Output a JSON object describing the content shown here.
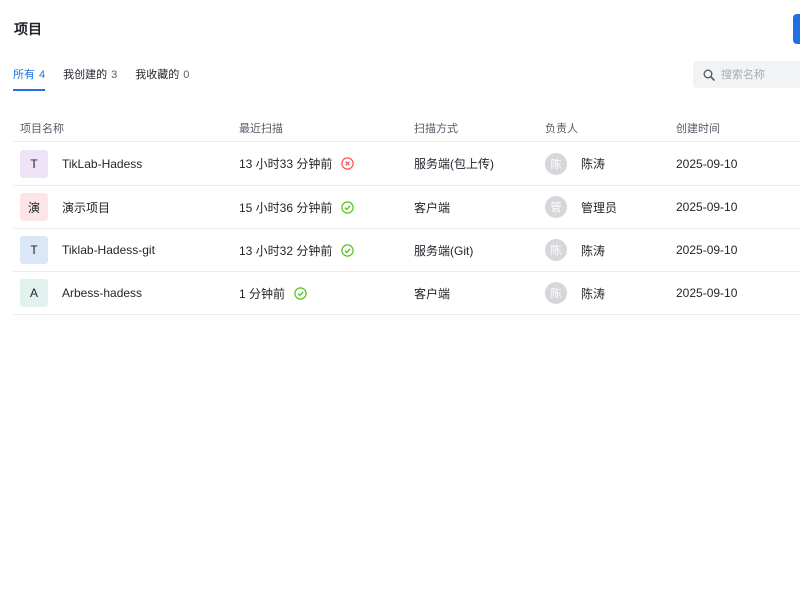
{
  "header": {
    "title": "项目"
  },
  "tabs": [
    {
      "label": "所有",
      "count": "4",
      "active": true
    },
    {
      "label": "我创建的",
      "count": "3",
      "active": false
    },
    {
      "label": "我收藏的",
      "count": "0",
      "active": false
    }
  ],
  "search": {
    "placeholder": "搜索名称",
    "value": "",
    "icon": "search-icon"
  },
  "table": {
    "columns": [
      "项目名称",
      "最近扫描",
      "扫描方式",
      "负责人",
      "创建时间"
    ],
    "rows": [
      {
        "avatar_letter": "T",
        "avatar_color": "#efe3f8",
        "name": "TikLab-Hadess",
        "last_scan": "13 小时33 分钟前",
        "scan_status": "failed",
        "status_color": "#f0565a",
        "scan_mode": "服务端(包上传)",
        "owner_avatar": "陈",
        "owner": "陈涛",
        "created": "2025-09-10"
      },
      {
        "avatar_letter": "演",
        "avatar_color": "#fbe5e6",
        "name": "演示项目",
        "last_scan": "15 小时36 分钟前",
        "scan_status": "success",
        "status_color": "#52c41a",
        "scan_mode": "客户端",
        "owner_avatar": "管",
        "owner": "管理员",
        "created": "2025-09-10"
      },
      {
        "avatar_letter": "T",
        "avatar_color": "#dbe6f7",
        "name": "Tiklab-Hadess-git",
        "last_scan": "13 小时32 分钟前",
        "scan_status": "success",
        "status_color": "#52c41a",
        "scan_mode": "服务端(Git)",
        "owner_avatar": "陈",
        "owner": "陈涛",
        "created": "2025-09-10"
      },
      {
        "avatar_letter": "A",
        "avatar_color": "#e1f1ee",
        "name": "Arbess-hadess",
        "last_scan": "1 分钟前",
        "scan_status": "success",
        "status_color": "#52c41a",
        "scan_mode": "客户端",
        "owner_avatar": "陈",
        "owner": "陈涛",
        "created": "2025-09-10"
      }
    ]
  },
  "colors": {
    "accent": "#1f6fe5",
    "success": "#52c41a",
    "error": "#f0565a"
  }
}
